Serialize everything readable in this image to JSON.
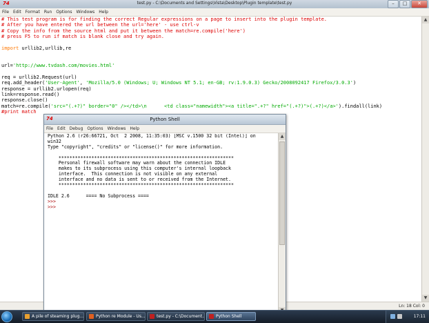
{
  "editor": {
    "title": "test.py - C:\\Documents and Settings\\Vista\\Desktop\\Plugin template\\test.py",
    "menu": [
      "File",
      "Edit",
      "Format",
      "Run",
      "Options",
      "Windows",
      "Help"
    ],
    "status": "Ln: 18 Col: 0",
    "lines": [
      [
        {
          "t": "# This test program is for finding the correct Regular expressions on a page to insert into the plugin template.",
          "c": "comment"
        }
      ],
      [
        {
          "t": "# After you have entered the url between the url='here' - use ctrl-v",
          "c": "comment"
        }
      ],
      [
        {
          "t": "# Copy the info from the source html and put it between the match=re.compile('here')",
          "c": "comment"
        }
      ],
      [
        {
          "t": "# press F5 to run if match is blank close and try again.",
          "c": "comment"
        }
      ],
      [],
      [
        {
          "t": "import",
          "c": "keyword"
        },
        {
          "t": " urllib2,urllib,re",
          "c": "plain"
        }
      ],
      [],
      [],
      [
        {
          "t": "url=",
          "c": "plain"
        },
        {
          "t": "'http://www.tvdash.com/movies.html'",
          "c": "string"
        }
      ],
      [],
      [
        {
          "t": "req = urllib2.Request(url)",
          "c": "plain"
        }
      ],
      [
        {
          "t": "req.add_header(",
          "c": "plain"
        },
        {
          "t": "'User-Agent'",
          "c": "string"
        },
        {
          "t": ", ",
          "c": "plain"
        },
        {
          "t": "'Mozilla/5.0 (Windows; U; Windows NT 5.1; en-GB; rv:1.9.0.3) Gecko/2008092417 Firefox/3.0.3'",
          "c": "string"
        },
        {
          "t": ")",
          "c": "plain"
        }
      ],
      [
        {
          "t": "response = urllib2.urlopen(req)",
          "c": "plain"
        }
      ],
      [
        {
          "t": "link=response.read()",
          "c": "plain"
        }
      ],
      [
        {
          "t": "response.close()",
          "c": "plain"
        }
      ],
      [
        {
          "t": "match=re.compile(",
          "c": "plain"
        },
        {
          "t": "'src=\"(.+?)\" border=\"0\" /></td>\\n      <td class=\"namewidth\"><a title=\".+?\" href=\"(.+?)\">(.+?)</a>'",
          "c": "string"
        },
        {
          "t": ").findall(link)",
          "c": "plain"
        }
      ],
      [
        {
          "t": "#print match",
          "c": "comment"
        }
      ]
    ]
  },
  "shell": {
    "title": "Python Shell",
    "menu": [
      "File",
      "Edit",
      "Debug",
      "Options",
      "Windows",
      "Help"
    ],
    "lines": [
      {
        "t": "Python 2.6 (r26:66721, Oct  2 2008, 11:35:03) [MSC v.1500 32 bit (Intel)] on",
        "c": "plain"
      },
      {
        "t": "win32",
        "c": "plain"
      },
      {
        "t": "Type \"copyright\", \"credits\" or \"license()\" for more information.",
        "c": "plain"
      },
      {
        "t": "",
        "c": "plain"
      },
      {
        "t": "    ****************************************************************",
        "c": "plain"
      },
      {
        "t": "    Personal firewall software may warn about the connection IDLE",
        "c": "plain"
      },
      {
        "t": "    makes to its subprocess using this computer's internal loopback",
        "c": "plain"
      },
      {
        "t": "    interface.  This connection is not visible on any external",
        "c": "plain"
      },
      {
        "t": "    interface and no data is sent to or received from the Internet.",
        "c": "plain"
      },
      {
        "t": "    ****************************************************************",
        "c": "plain"
      },
      {
        "t": "",
        "c": "plain"
      },
      {
        "t": "IDLE 2.6      ==== No Subprocess ====",
        "c": "plain"
      },
      {
        "t": ">>> ",
        "c": "prompt"
      },
      {
        "t": ">>> ",
        "c": "prompt"
      }
    ]
  },
  "taskbar": {
    "buttons": [
      {
        "label": "A pile of steaming plug...",
        "color": "#e8a030",
        "active": false
      },
      {
        "label": "Python re Module - Us...",
        "color": "#e06020",
        "active": false
      },
      {
        "label": "test.py - C:\\Document...",
        "color": "#c02020",
        "active": false
      },
      {
        "label": "Python Shell",
        "color": "#c02020",
        "active": true
      }
    ],
    "clock": "17:11"
  }
}
